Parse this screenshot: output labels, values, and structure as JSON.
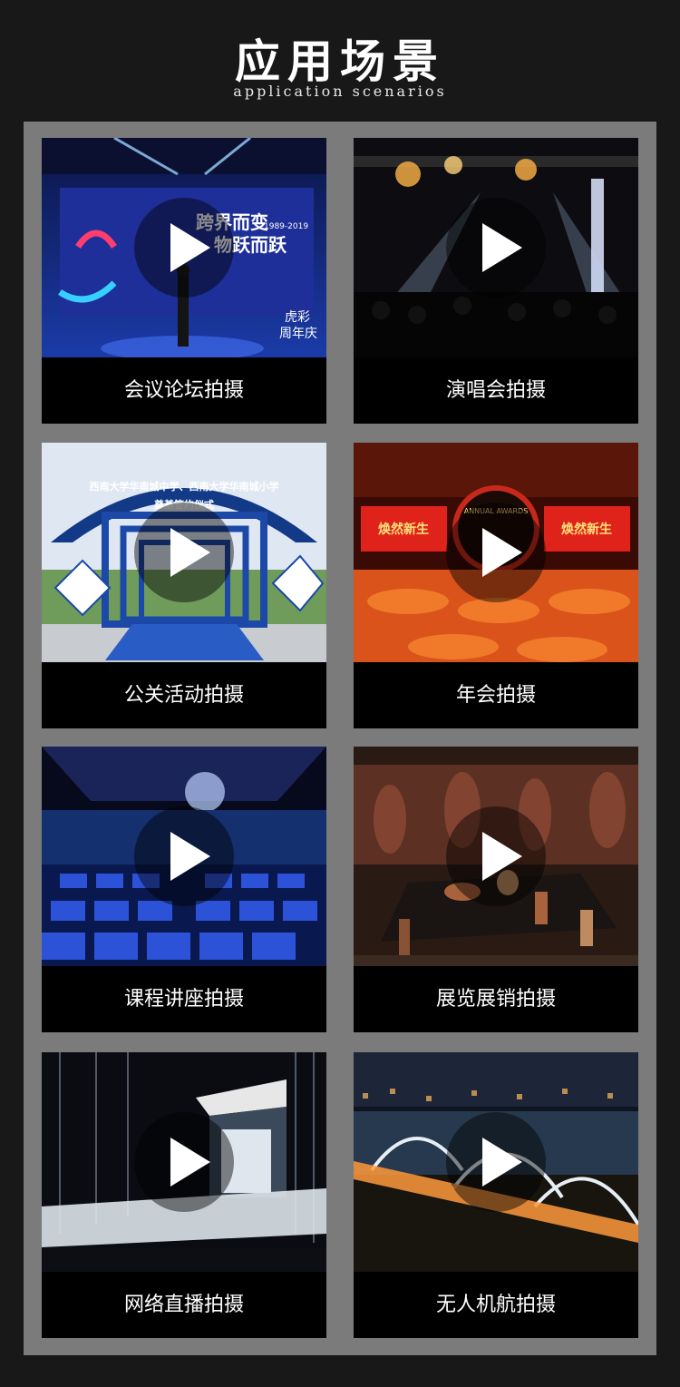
{
  "header": {
    "title": "应用场景",
    "subtitle": "application scenarios"
  },
  "cards": [
    {
      "caption": "会议论坛拍摄",
      "icon": "play-icon"
    },
    {
      "caption": "演唱会拍摄",
      "icon": "play-icon"
    },
    {
      "caption": "公关活动拍摄",
      "icon": "play-icon"
    },
    {
      "caption": "年会拍摄",
      "icon": "play-icon"
    },
    {
      "caption": "课程讲座拍摄",
      "icon": "play-icon"
    },
    {
      "caption": "展览展销拍摄",
      "icon": "play-icon"
    },
    {
      "caption": "网络直播拍摄",
      "icon": "play-icon"
    },
    {
      "caption": "无人机航拍摄",
      "icon": "play-icon"
    }
  ],
  "thumb_text": {
    "forum_slogan_1": "跨界而变",
    "forum_slogan_2": "物跃而跃",
    "forum_years": "1989-2019",
    "forum_brand": "虎彩",
    "forum_anniv": "周年庆",
    "pr_banner_1": "西南大学华南城中学、西南大学华南城小学",
    "pr_banner_2": "奠基签约仪式",
    "gala_screen": "ANNUAL AWARDS",
    "gala_slogan": "焕然新生"
  },
  "colors": {
    "page_bg": "#181818",
    "panel_bg": "#7b7b7b",
    "card_bg": "#000000",
    "caption_text": "#ffffff"
  }
}
